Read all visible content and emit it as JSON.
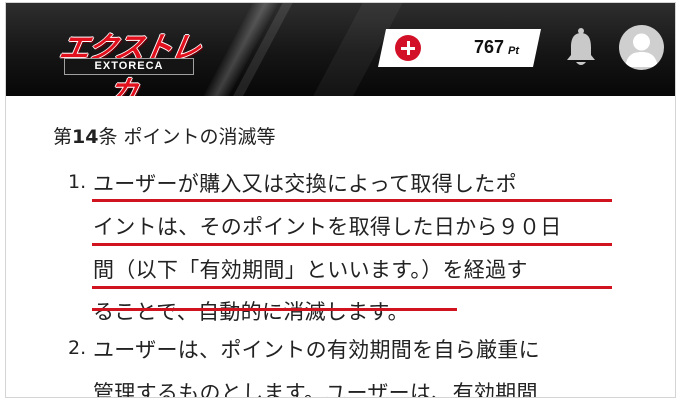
{
  "header": {
    "logo_text": "エクストレカ",
    "logo_subtext": "EXTORECA",
    "points_value": "767",
    "points_unit": "Pt",
    "icons": {
      "add": "plus-circle-icon",
      "notifications": "bell-icon",
      "profile": "user-avatar-icon"
    },
    "colors": {
      "brand_red": "#d21027",
      "header_bg": "#111111"
    }
  },
  "article": {
    "section_label_prefix": "第",
    "section_number": "14",
    "section_label_suffix": "条",
    "section_title": "ポイントの消滅等",
    "items": [
      {
        "number": "1.",
        "lines": [
          "ユーザーが購入又は交換によって取得したポ",
          "イントは、そのポイントを取得した日から９０日",
          "間（以下「有効期間」といいます。）を経過す",
          "ることで、自動的に消滅します。"
        ],
        "highlighted": true,
        "highlight_color": "#d1121f"
      },
      {
        "number": "2.",
        "lines": [
          "ユーザーは、ポイントの有効期間を自ら厳重に",
          "管理するものとします。ユーザーは、有効期間"
        ],
        "highlighted": false
      }
    ]
  }
}
